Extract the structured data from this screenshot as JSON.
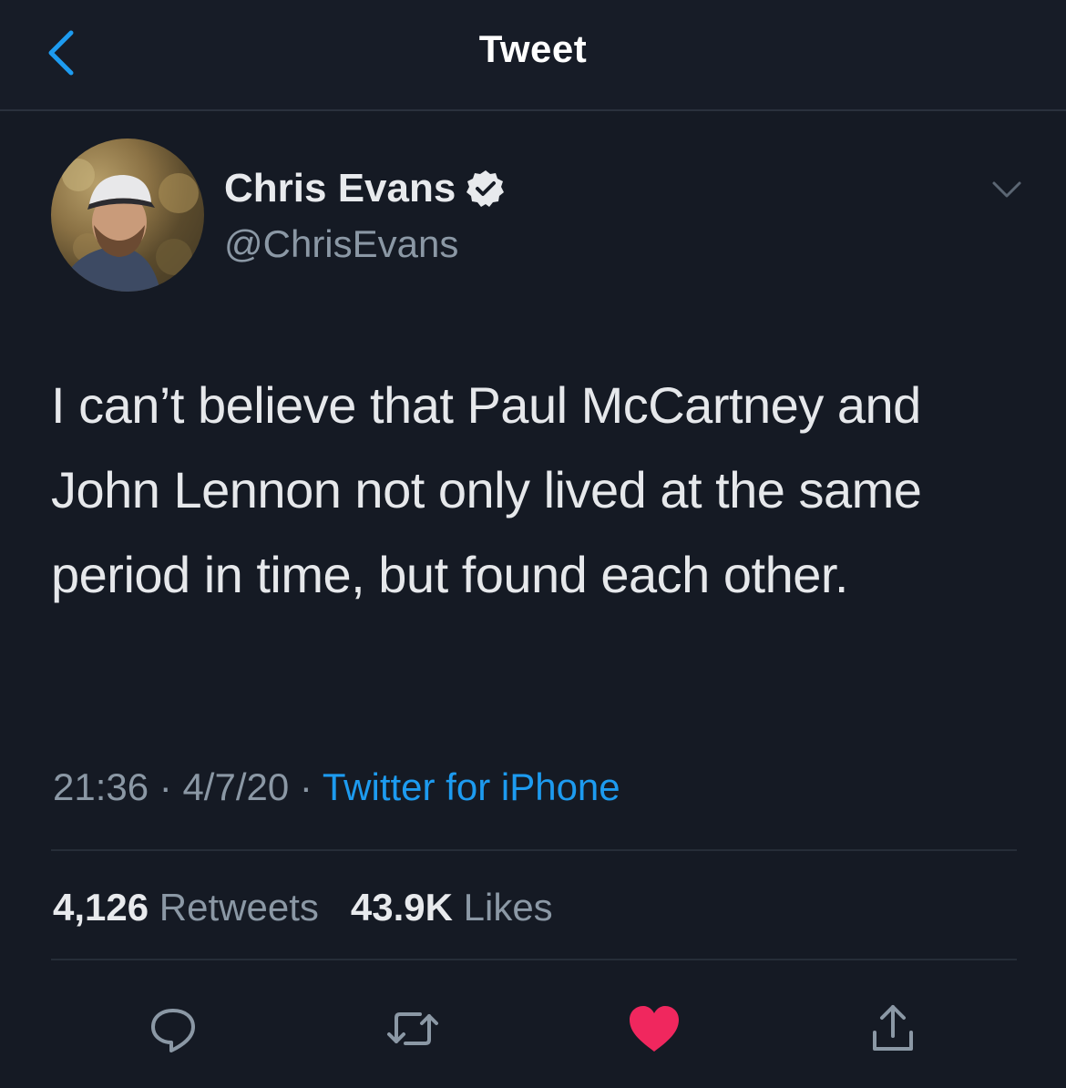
{
  "header": {
    "title": "Tweet",
    "back_icon": "chevron-left-icon"
  },
  "tweet": {
    "author": {
      "display_name": "Chris Evans",
      "handle": "@ChrisEvans",
      "verified": true
    },
    "text": "I can’t believe that Paul McCartney and John Lennon not only lived at the same period in time, but found each other.",
    "time": "21:36",
    "date": "4/7/20",
    "separator": "·",
    "source": "Twitter for iPhone"
  },
  "stats": {
    "retweets_count": "4,126",
    "retweets_label": "Retweets",
    "likes_count": "43.9K",
    "likes_label": "Likes"
  },
  "actions": [
    "reply-icon",
    "retweet-icon",
    "like-icon",
    "share-icon"
  ],
  "colors": {
    "background": "#151a24",
    "accent": "#1d9bf0",
    "like": "#f0275e",
    "secondary_text": "#8b98a5"
  }
}
